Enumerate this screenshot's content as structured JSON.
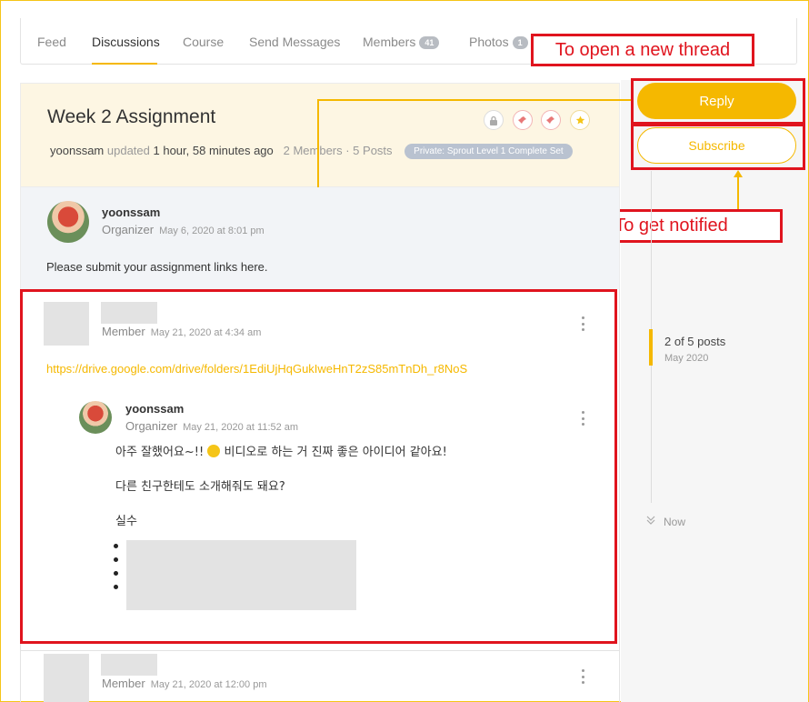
{
  "tabs": [
    {
      "label": "Feed"
    },
    {
      "label": "Discussions"
    },
    {
      "label": "Course"
    },
    {
      "label": "Send Messages"
    },
    {
      "label": "Members",
      "count": "41"
    },
    {
      "label": "Photos",
      "count": "1"
    }
  ],
  "annotations": {
    "new_thread": "To open a new thread",
    "notified": "To get notified"
  },
  "topic": {
    "title": "Week 2 Assignment",
    "author": "yoonssam",
    "updated_word": "updated",
    "updated_time": "1 hour, 58 minutes ago",
    "stats": "2 Members · 5 Posts",
    "badge": "Private: Sprout Level 1 Complete Set"
  },
  "actions": {
    "reply": "Reply",
    "subscribe": "Subscribe"
  },
  "first_post": {
    "author": "yoonssam",
    "role": "Organizer",
    "date": "May 6, 2020 at 8:01 pm",
    "body": "Please submit your assignment links here."
  },
  "post2": {
    "role": "Member",
    "date": "May 21, 2020 at 4:34 am",
    "link": "https://drive.google.com/drive/folders/1EdiUjHqGukIweHnT2zS85mTnDh_r8NoS"
  },
  "reply": {
    "author": "yoonssam",
    "role": "Organizer",
    "date": "May 21, 2020 at 11:52 am",
    "line1_a": "아주 잘했어요~!!",
    "line1_b": "비디오로 하는 거 진짜 좋은 아이디어 같아요!",
    "line2": "다른 친구한테도 소개해줘도 돼요?",
    "line3": "실수"
  },
  "post3": {
    "role": "Member",
    "date": "May 21, 2020 at 12:00 pm"
  },
  "timeline": {
    "position": "2 of 5 posts",
    "month": "May 2020",
    "now": "Now"
  },
  "colors": {
    "accent": "#f5b800",
    "annotation": "#e0141e",
    "header_bg": "#fdf6e3"
  }
}
